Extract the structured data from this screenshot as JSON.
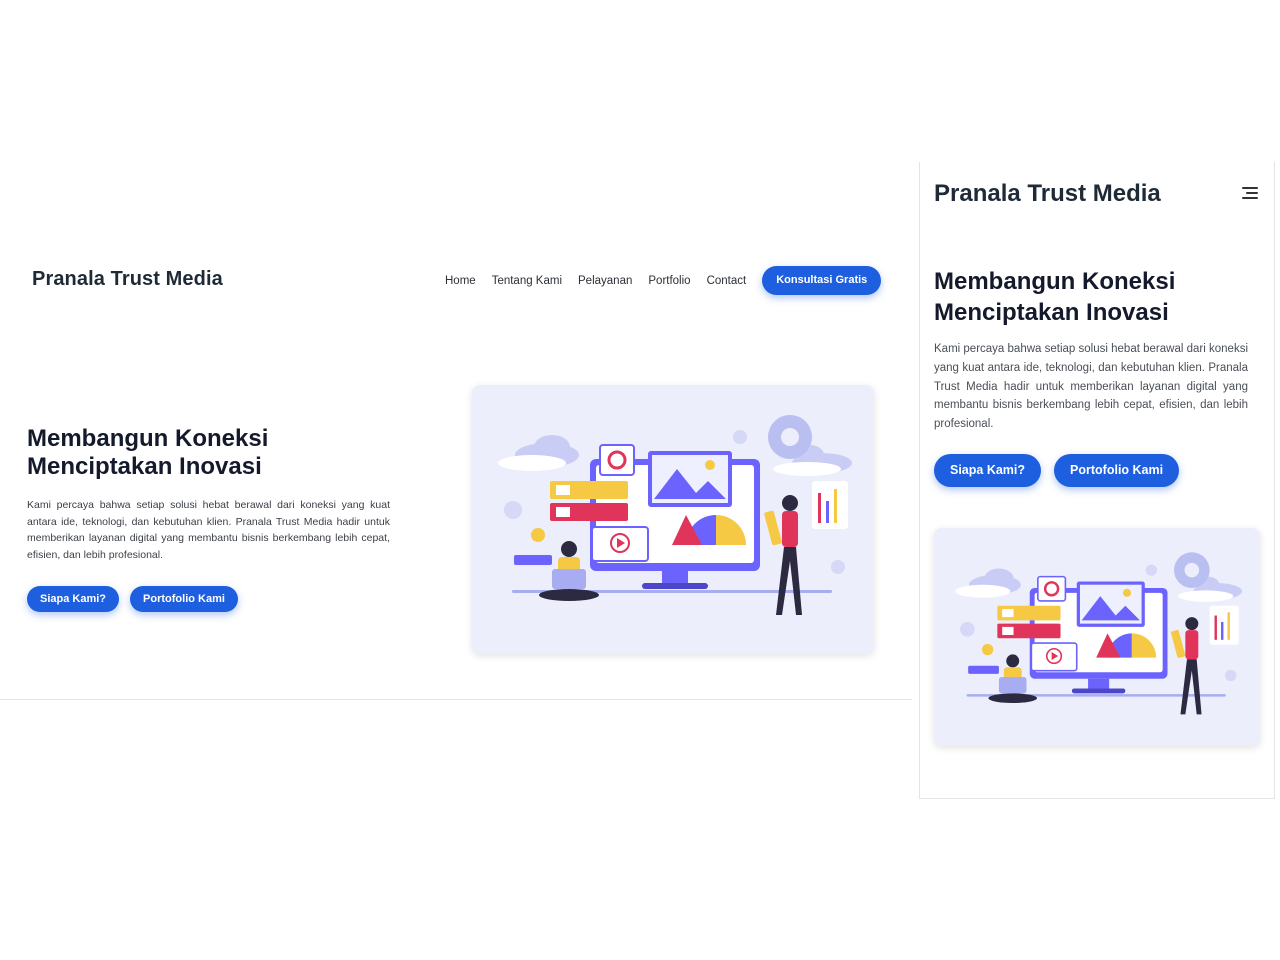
{
  "brand": "Pranala Trust Media",
  "nav": {
    "items": [
      "Home",
      "Tentang Kami",
      "Pelayanan",
      "Portfolio",
      "Contact"
    ],
    "cta": "Konsultasi Gratis"
  },
  "hero": {
    "title_line1": "Membangun Koneksi",
    "title_line2": "Menciptakan Inovasi",
    "description": "Kami percaya bahwa setiap solusi hebat berawal dari koneksi yang kuat antara ide, teknologi, dan kebutuhan klien. Pranala Trust Media hadir untuk memberikan layanan digital yang membantu bisnis berkembang lebih cepat, efisien, dan lebih profesional.",
    "button_primary": "Siapa Kami?",
    "button_secondary": "Portofolio Kami"
  },
  "colors": {
    "accent": "#1e5fe0",
    "card_bg": "#eceefc",
    "illustration_purple": "#6c63ff",
    "illustration_red": "#e0345a",
    "illustration_yellow": "#f6c944"
  },
  "icons": {
    "menu": "hamburger-menu-icon"
  }
}
